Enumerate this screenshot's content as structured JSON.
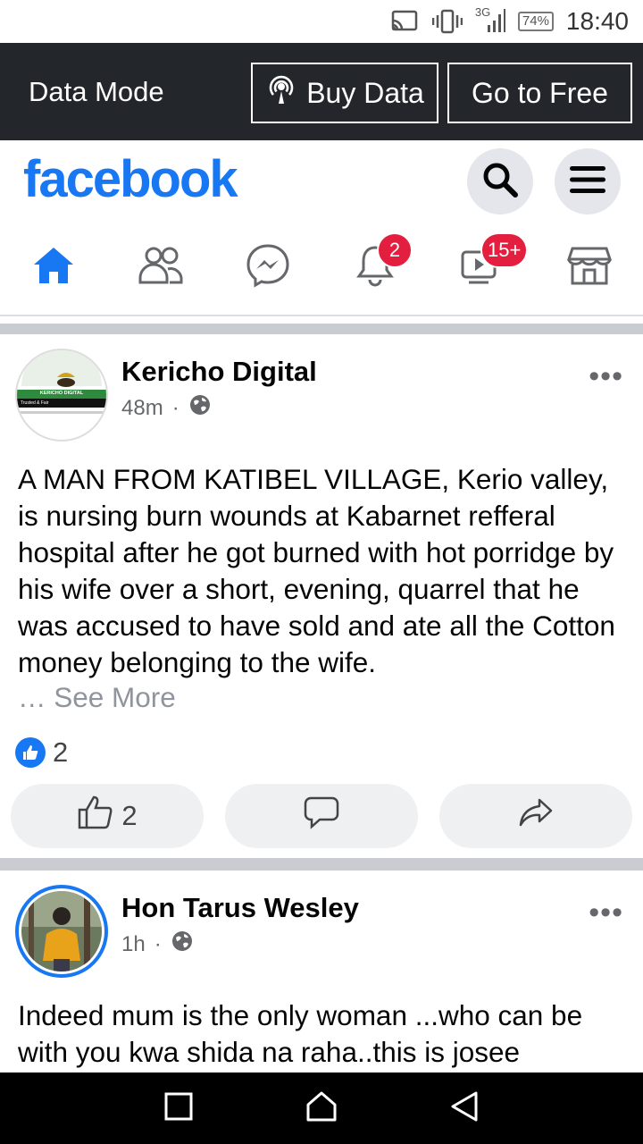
{
  "status_bar": {
    "network": "3G",
    "battery": "74%",
    "time": "18:40",
    "icons": [
      "cast-icon",
      "vibrate-icon",
      "signal-icon",
      "battery-icon"
    ]
  },
  "data_bar": {
    "mode_label": "Data Mode",
    "buy_data_label": "Buy Data",
    "go_free_label": "Go to Free"
  },
  "header": {
    "logo": "facebook",
    "icons": [
      "search-icon",
      "menu-icon"
    ]
  },
  "nav": {
    "tabs": [
      {
        "name": "home",
        "active": true
      },
      {
        "name": "friends"
      },
      {
        "name": "messenger"
      },
      {
        "name": "notifications",
        "badge": "2"
      },
      {
        "name": "watch",
        "badge": "15+"
      },
      {
        "name": "marketplace"
      }
    ]
  },
  "posts": [
    {
      "author": "Kericho Digital",
      "time": "48m",
      "avatar_text": [
        "KERICHO DIGITAL",
        "Trusted & Fair"
      ],
      "text": "A MAN FROM KATIBEL VILLAGE, Kerio valley, is  nursing burn wounds at Kabarnet refferal hospital after he got burned with hot porridge by his wife over a short, evening, quarrel that he was accused to have sold and ate all the Cotton money belonging to the wife.",
      "see_more": "… See More",
      "reaction_count": "2",
      "like_count": "2"
    },
    {
      "author": "Hon Tarus Wesley",
      "time": "1h",
      "text": "Indeed mum is the only woman ...who can be with you kwa shida na raha..this is josee"
    }
  ],
  "colors": {
    "brand": "#1877f2",
    "badge": "#e41e3f",
    "data_bar": "#23262b"
  }
}
